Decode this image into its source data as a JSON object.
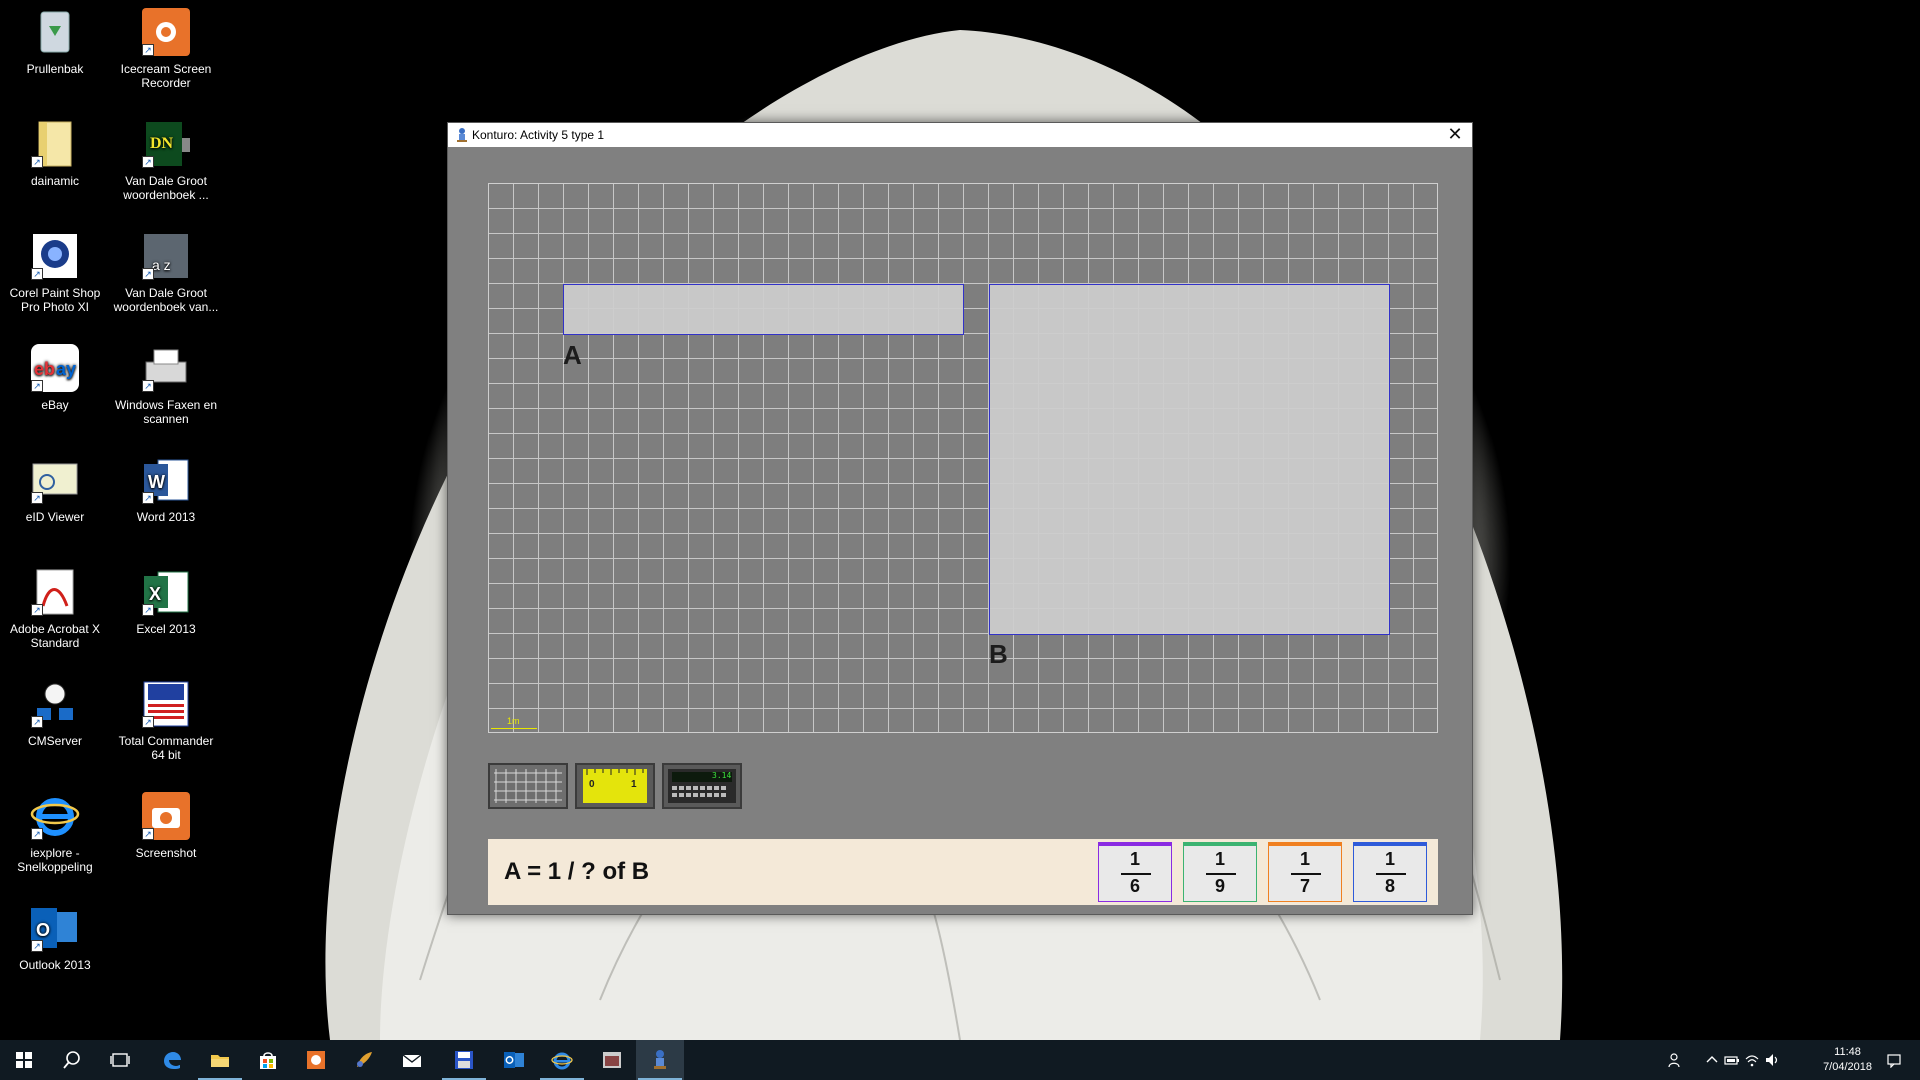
{
  "desktop": {
    "icons": [
      {
        "label": "Prullenbak",
        "icon": "recycle-bin-icon"
      },
      {
        "label": "Icecream Screen Recorder",
        "icon": "screen-recorder-icon"
      },
      {
        "label": "dainamic",
        "icon": "folder-icon"
      },
      {
        "label": "Van Dale Groot woordenboek ...",
        "icon": "dictionary-icon"
      },
      {
        "label": "Corel Paint Shop Pro Photo XI",
        "icon": "paint-shop-icon"
      },
      {
        "label": "Van Dale Groot woordenboek van...",
        "icon": "dictionary-az-icon"
      },
      {
        "label": "eBay",
        "icon": "ebay-icon"
      },
      {
        "label": "Windows Faxen en scannen",
        "icon": "fax-scanner-icon"
      },
      {
        "label": "eID Viewer",
        "icon": "eid-viewer-icon"
      },
      {
        "label": "Word 2013",
        "icon": "word-icon"
      },
      {
        "label": "Adobe Acrobat X Standard",
        "icon": "acrobat-icon"
      },
      {
        "label": "Excel 2013",
        "icon": "excel-icon"
      },
      {
        "label": "CMServer",
        "icon": "cmserver-icon"
      },
      {
        "label": "Total Commander 64 bit",
        "icon": "total-commander-icon"
      },
      {
        "label": "iexplore - Snelkoppeling",
        "icon": "internet-explorer-icon"
      },
      {
        "label": "Screenshot",
        "icon": "camera-icon"
      },
      {
        "label": "Outlook 2013",
        "icon": "outlook-icon"
      }
    ]
  },
  "window": {
    "title": "Konturo: Activity 5 type 1",
    "close_label": "✕",
    "shape_a_label": "A",
    "shape_b_label": "B",
    "scale_label": "1m",
    "tools": [
      {
        "name": "grid-tool",
        "icon": "grid-icon"
      },
      {
        "name": "ruler-tool",
        "icon": "ruler-icon",
        "ruler_left": "0",
        "ruler_right": "1"
      },
      {
        "name": "calculator-tool",
        "icon": "calculator-icon",
        "display": "3.14"
      }
    ],
    "question": "A = 1 / ? of B",
    "choices": [
      {
        "numerator": "1",
        "denominator": "6",
        "color": "#8a2be2"
      },
      {
        "numerator": "1",
        "denominator": "9",
        "color": "#3cb371"
      },
      {
        "numerator": "1",
        "denominator": "7",
        "color": "#f08020"
      },
      {
        "numerator": "1",
        "denominator": "8",
        "color": "#2f5bd9"
      }
    ]
  },
  "taskbar": {
    "time": "11:48",
    "date": "7/04/2018"
  }
}
